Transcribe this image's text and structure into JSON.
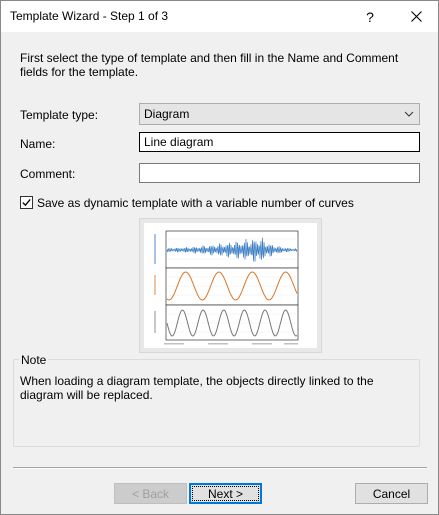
{
  "window": {
    "title": "Template Wizard - Step 1 of 3",
    "help_label": "?"
  },
  "intro": "First select the type of template and then fill in the Name and Comment fields for the template.",
  "form": {
    "type_label": "Template type:",
    "type_value": "Diagram",
    "name_label": "Name:",
    "name_value": "Line diagram",
    "comment_label": "Comment:",
    "comment_value": "",
    "dynamic_label": "Save as dynamic template with a variable number of curves",
    "dynamic_checked": true
  },
  "preview": {
    "icon": "diagram-preview",
    "colors": {
      "blue": "#3d7fc4",
      "orange": "#d8762a",
      "gray": "#777777"
    }
  },
  "note": {
    "title": "Note",
    "text": "When loading a diagram template, the objects directly linked to the diagram will be replaced."
  },
  "buttons": {
    "back": "< Back",
    "next": "Next >",
    "cancel": "Cancel"
  }
}
